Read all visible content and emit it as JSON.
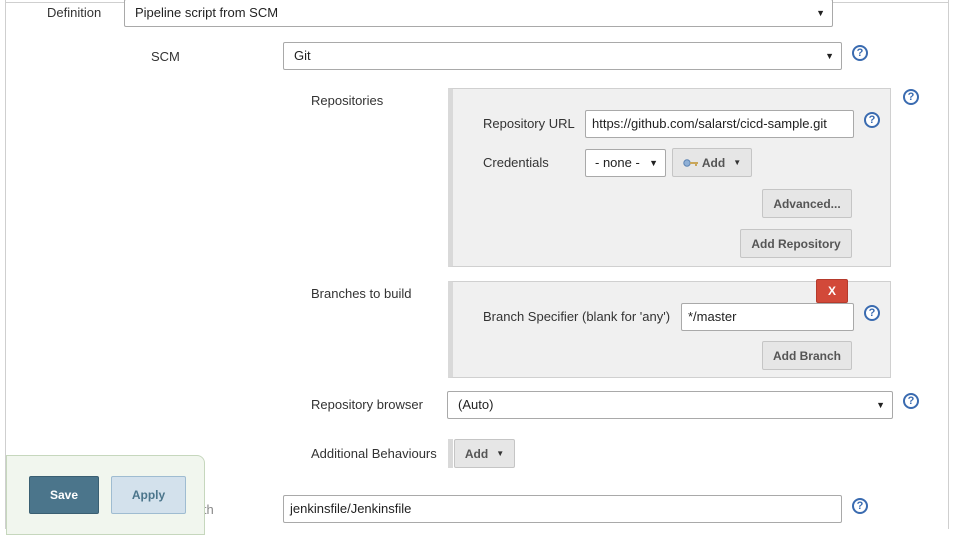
{
  "definition": {
    "label": "Definition",
    "value": "Pipeline script from SCM"
  },
  "scm": {
    "label": "SCM",
    "value": "Git"
  },
  "repositories": {
    "label": "Repositories",
    "url_label": "Repository URL",
    "url_value": "https://github.com/salarst/cicd-sample.git",
    "credentials_label": "Credentials",
    "credentials_value": "- none -",
    "add_label": "Add",
    "advanced_label": "Advanced...",
    "add_repository_label": "Add Repository"
  },
  "branches": {
    "label": "Branches to build",
    "delete_label": "X",
    "specifier_label": "Branch Specifier (blank for 'any')",
    "specifier_value": "*/master",
    "add_branch_label": "Add Branch"
  },
  "repo_browser": {
    "label": "Repository browser",
    "value": "(Auto)"
  },
  "additional_behaviours": {
    "label": "Additional Behaviours",
    "add_label": "Add"
  },
  "script_path": {
    "label_fragment": "Path",
    "value": "jenkinsfile/Jenkinsfile"
  },
  "actions": {
    "save_label": "Save",
    "apply_label": "Apply"
  },
  "icons": {
    "help": "help-icon",
    "credentials_key": "key-icon",
    "dropdown": "caret-down-icon"
  },
  "colors": {
    "help": "#3a6bb0",
    "delete": "#d24939",
    "save": "#4b758b",
    "apply": "#d3e1ec"
  }
}
